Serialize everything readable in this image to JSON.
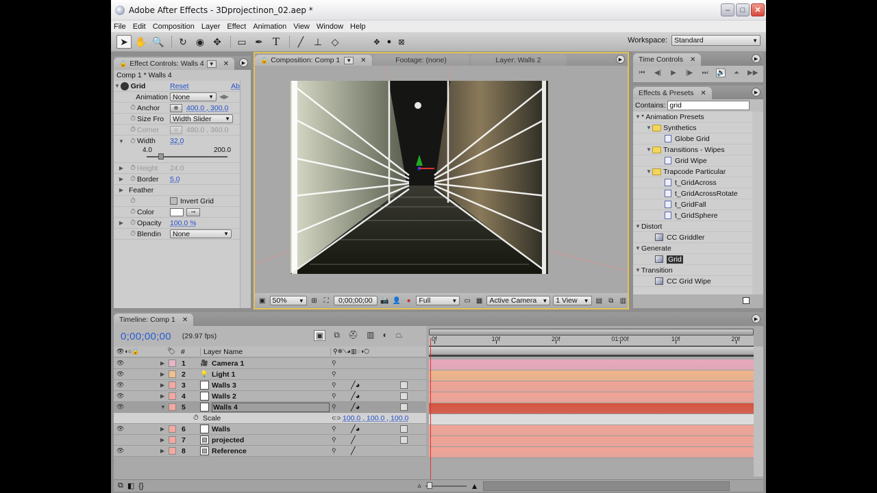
{
  "window": {
    "title": "Adobe After Effects - 3Dprojectinon_02.aep *",
    "buttons": {
      "minimize": "–",
      "maximize": "□",
      "close": "✕"
    }
  },
  "menu": [
    "File",
    "Edit",
    "Composition",
    "Layer",
    "Effect",
    "Animation",
    "View",
    "Window",
    "Help"
  ],
  "toolbar": {
    "tools": [
      {
        "name": "selection-tool-icon",
        "glyph": "➤"
      },
      {
        "name": "hand-tool-icon",
        "glyph": "✋"
      },
      {
        "name": "zoom-tool-icon",
        "glyph": "🔍"
      },
      {
        "name": "rotate-tool-icon",
        "glyph": "↻"
      },
      {
        "name": "orbit-camera-tool-icon",
        "glyph": "◉"
      },
      {
        "name": "track-xy-camera-tool-icon",
        "glyph": "✥"
      },
      {
        "name": "rectangle-mask-tool-icon",
        "glyph": "▭"
      },
      {
        "name": "pen-tool-icon",
        "glyph": "✒"
      },
      {
        "name": "text-tool-icon",
        "glyph": "T"
      },
      {
        "name": "brush-tool-icon",
        "glyph": "╱"
      },
      {
        "name": "clone-stamp-tool-icon",
        "glyph": "⊥"
      },
      {
        "name": "eraser-tool-icon",
        "glyph": "◇"
      }
    ],
    "axis_modes": [
      "✥",
      "●",
      "⊠"
    ],
    "workspace_label": "Workspace:",
    "workspace_value": "Standard"
  },
  "effect_controls": {
    "tab_label": "Effect Controls: Walls 4",
    "subtitle": "Comp 1 * Walls 4",
    "effect_name": "Grid",
    "reset_label": "Reset",
    "about_label": "Ab",
    "animation_label": "Animation",
    "animation_value": "None",
    "properties": [
      {
        "name": "Anchor",
        "value": "400.0 , 300.0",
        "type": "point"
      },
      {
        "name": "Size Fro",
        "value": "Width Slider",
        "type": "dropdown"
      },
      {
        "name": "Corner",
        "value": "480.0 , 360.0",
        "type": "point",
        "disabled": true
      },
      {
        "name": "Width",
        "value": "32.0",
        "type": "slider",
        "min": "4.0",
        "max": "200.0",
        "fraction": 0.145
      },
      {
        "name": "Height",
        "value": "24.0",
        "type": "value",
        "disabled": true
      },
      {
        "name": "Border",
        "value": "5.0",
        "type": "value"
      },
      {
        "name": "Feather",
        "value": "",
        "type": "group"
      },
      {
        "name": "",
        "value": "Invert Grid",
        "type": "checkbox",
        "checked": false
      },
      {
        "name": "Color",
        "value": "#ffffff",
        "type": "color"
      },
      {
        "name": "Opacity",
        "value": "100.0 %",
        "type": "value"
      },
      {
        "name": "Blendin",
        "value": "None",
        "type": "dropdown"
      }
    ]
  },
  "composition": {
    "tabs": [
      "Composition: Comp 1",
      "Footage: (none)",
      "Layer: Walls 2"
    ],
    "footer": {
      "magnification": "50%",
      "timecode": "0;00;00;00",
      "resolution": "Full",
      "camera": "Active Camera",
      "views": "1 View"
    }
  },
  "time_controls": {
    "tab_label": "Time Controls",
    "buttons": [
      "⏮",
      "◀|",
      "▶",
      "|▶",
      "⏭",
      "🔊",
      "⏶",
      "▶▶"
    ]
  },
  "effects_presets": {
    "tab_label": "Effects & Presets",
    "contains_label": "Contains:",
    "search_value": "grid",
    "tree": [
      {
        "level": 0,
        "type": "group",
        "label": "* Animation Presets"
      },
      {
        "level": 1,
        "type": "folder",
        "label": "Synthetics"
      },
      {
        "level": 2,
        "type": "preset",
        "label": "Globe Grid"
      },
      {
        "level": 1,
        "type": "folder",
        "label": "Transitions - Wipes"
      },
      {
        "level": 2,
        "type": "preset",
        "label": "Grid Wipe"
      },
      {
        "level": 1,
        "type": "folder",
        "label": "Trapcode Particular"
      },
      {
        "level": 2,
        "type": "preset",
        "label": "t_GridAcross"
      },
      {
        "level": 2,
        "type": "preset",
        "label": "t_GridAcrossRotate"
      },
      {
        "level": 2,
        "type": "preset",
        "label": "t_GridFall"
      },
      {
        "level": 2,
        "type": "preset",
        "label": "t_GridSphere"
      },
      {
        "level": 0,
        "type": "group",
        "label": "Distort"
      },
      {
        "level": 1,
        "type": "effect",
        "label": "CC Griddler"
      },
      {
        "level": 0,
        "type": "group",
        "label": "Generate"
      },
      {
        "level": 1,
        "type": "effect",
        "label": "Grid",
        "selected": true
      },
      {
        "level": 0,
        "type": "group",
        "label": "Transition"
      },
      {
        "level": 1,
        "type": "effect",
        "label": "CC Grid Wipe"
      }
    ]
  },
  "timeline": {
    "tab_label": "Timeline: Comp 1",
    "timecode": "0;00;00;00",
    "fps": "(29.97 fps)",
    "column_headers": {
      "number": "#",
      "layer_name": "Layer Name"
    },
    "ruler_ticks": [
      "0f",
      "10f",
      "20f",
      "01:00f",
      "10f",
      "20f"
    ],
    "layers": [
      {
        "num": "1",
        "name": "Camera 1",
        "source": "camera",
        "label_color": "#e8b4c8",
        "bar_color": "#eaa8bc",
        "visible": true,
        "fx": false,
        "three_d": false
      },
      {
        "num": "2",
        "name": "Light 1",
        "source": "light",
        "label_color": "#f2c08c",
        "bar_color": "#f0b48a",
        "visible": true,
        "fx": false,
        "three_d": false
      },
      {
        "num": "3",
        "name": "Walls 3",
        "source": "solid",
        "label_color": "#f4a8a0",
        "bar_color": "#f3a396",
        "visible": true,
        "fx": true,
        "three_d": true
      },
      {
        "num": "4",
        "name": "Walls 2",
        "source": "solid",
        "label_color": "#f4a8a0",
        "bar_color": "#f3a396",
        "visible": true,
        "fx": true,
        "three_d": true
      },
      {
        "num": "5",
        "name": "Walls 4",
        "source": "solid",
        "label_color": "#f4a8a0",
        "bar_color": "#d9533f",
        "visible": true,
        "fx": true,
        "three_d": true,
        "selected": true,
        "expanded": true
      },
      {
        "num": "6",
        "name": "Walls",
        "source": "solid",
        "label_color": "#f4a8a0",
        "bar_color": "#f3a396",
        "visible": true,
        "fx": true,
        "three_d": true
      },
      {
        "num": "7",
        "name": "projected",
        "source": "footage",
        "label_color": "#f4a8a0",
        "bar_color": "#f3a396",
        "visible": false,
        "fx": false,
        "three_d": true
      },
      {
        "num": "8",
        "name": "Reference",
        "source": "footage",
        "label_color": "#f4a8a0",
        "bar_color": "#f3a396",
        "visible": true,
        "fx": false,
        "three_d": false
      }
    ],
    "sub_property": {
      "after_layer": "5",
      "name": "Scale",
      "value": "100.0 , 100.0 , 100.0"
    }
  }
}
